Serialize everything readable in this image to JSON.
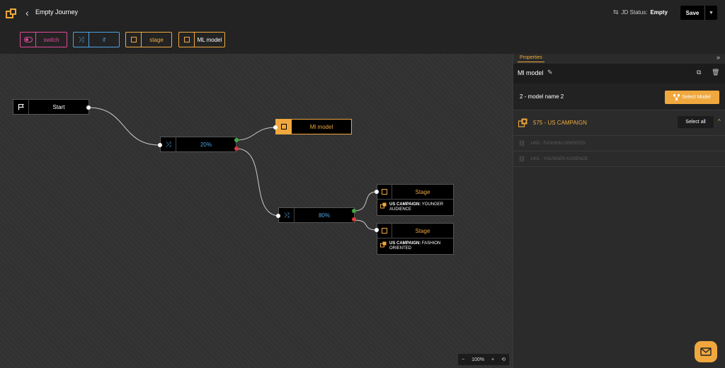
{
  "header": {
    "title": "Empty Journey",
    "status_label": "JD Status:",
    "status_value": "Empty",
    "save_label": "Save"
  },
  "toolbar": {
    "items": [
      {
        "label": "switch",
        "icon": "toggle-icon",
        "color": "#e0489a"
      },
      {
        "label": "if",
        "icon": "shuffle-icon",
        "color": "#4ea3e0"
      },
      {
        "label": "stage",
        "icon": "square-icon",
        "color": "#f0a83e"
      },
      {
        "label": "ML model",
        "icon": "square-icon",
        "color": "#f0a83e"
      }
    ]
  },
  "canvas": {
    "start": {
      "label": "Start"
    },
    "split1": {
      "label": "20%"
    },
    "ml_node": {
      "label": "Ml model"
    },
    "split2": {
      "label": "80%"
    },
    "stage1": {
      "label": "Stage",
      "campaign": "US CAMPAIGN:",
      "audience": "YOUNGER AUDIENCE"
    },
    "stage2": {
      "label": "Stage",
      "campaign": "US CAMPAIGN:",
      "audience": "FASHION ORIENTED"
    },
    "zoom_level": "100%"
  },
  "properties": {
    "tab_label": "Properties",
    "node_title": "Ml model",
    "model_name": "2 - model name 2",
    "select_model_label": "Select Model",
    "campaign": {
      "name": "575 - US CAMPAIGN",
      "select_all_label": "Select all",
      "audiences": [
        {
          "label": "1450 - FASHION ORIENTED"
        },
        {
          "label": "1401 - YOUNGER AUDIENCE"
        }
      ]
    }
  },
  "colors": {
    "accent": "#f0a83e",
    "switch": "#e0489a",
    "if": "#4ea3e0",
    "port_true": "#3fa83f",
    "port_false": "#e03a3a"
  }
}
